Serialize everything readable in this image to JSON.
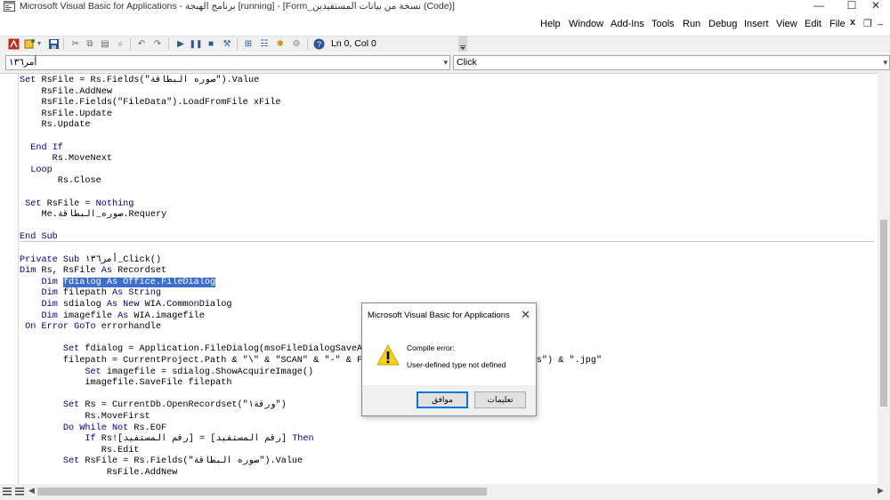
{
  "window": {
    "title": "Microsoft Visual Basic for Applications - برنامج الهبجة [running] - [Form_نسخة من  بيانات المستفيدين (Code)]",
    "minimize": "—",
    "maximize": "☐",
    "close": "✕"
  },
  "menubar": {
    "items": [
      "File",
      "Edit",
      "View",
      "Insert",
      "Debug",
      "Run",
      "Tools",
      "Add-Ins",
      "Window",
      "Help"
    ],
    "mdi_close": "x",
    "mdi_restore": "❐",
    "mdi_minimize": "_"
  },
  "toolbar": {
    "position": "Ln 0, Col 0"
  },
  "combos": {
    "object": "أمر١٣٦",
    "procedure": "Click"
  },
  "code_lines": [
    [
      {
        "t": "Set",
        "k": 1
      },
      {
        "t": " RsFile = Rs.Fields(\"صوره البطاقة\").Value"
      }
    ],
    [
      {
        "t": "    RsFile.AddNew"
      }
    ],
    [
      {
        "t": "    RsFile.Fields(\"FileData\").LoadFromFile xFile"
      }
    ],
    [
      {
        "t": "    RsFile.Update"
      }
    ],
    [
      {
        "t": "    Rs.Update"
      }
    ],
    [
      {
        "t": ""
      }
    ],
    [
      {
        "t": "  "
      },
      {
        "t": "End If",
        "k": 1
      }
    ],
    [
      {
        "t": "      Rs.MoveNext"
      }
    ],
    [
      {
        "t": "  "
      },
      {
        "t": "Loop",
        "k": 1
      }
    ],
    [
      {
        "t": "       Rs.Close"
      }
    ],
    [
      {
        "t": ""
      }
    ],
    [
      {
        "t": " "
      },
      {
        "t": "Set",
        "k": 1
      },
      {
        "t": " RsFile = "
      },
      {
        "t": "Nothing",
        "k": 1
      }
    ],
    [
      {
        "t": "    Me.صوره_البطاقة.Requery"
      }
    ],
    [
      {
        "t": ""
      }
    ],
    [
      {
        "t": "End Sub",
        "k": 1
      }
    ],
    [
      {
        "t": ""
      }
    ],
    [
      {
        "t": "Private Sub",
        "k": 1
      },
      {
        "t": " أمر١٣٦_Click()"
      }
    ],
    [
      {
        "t": "Dim",
        "k": 1
      },
      {
        "t": " Rs, RsFile "
      },
      {
        "t": "As",
        "k": 1
      },
      {
        "t": " Recordset"
      }
    ],
    [
      {
        "t": "    "
      },
      {
        "t": "Dim",
        "k": 1
      },
      {
        "t": " "
      },
      {
        "t": "fdialog As Office.FileDialog",
        "s": 1
      }
    ],
    [
      {
        "t": "    "
      },
      {
        "t": "Dim",
        "k": 1
      },
      {
        "t": " filepath "
      },
      {
        "t": "As String",
        "k": 1
      }
    ],
    [
      {
        "t": "    "
      },
      {
        "t": "Dim",
        "k": 1
      },
      {
        "t": " sdialog "
      },
      {
        "t": "As New",
        "k": 1
      },
      {
        "t": " WIA.CommonDialog"
      }
    ],
    [
      {
        "t": "    "
      },
      {
        "t": "Dim",
        "k": 1
      },
      {
        "t": " imagefile "
      },
      {
        "t": "As",
        "k": 1
      },
      {
        "t": " WIA.imagefile"
      }
    ],
    [
      {
        "t": " "
      },
      {
        "t": "On Error GoTo",
        "k": 1
      },
      {
        "t": " errorhandle"
      }
    ],
    [
      {
        "t": ""
      }
    ],
    [
      {
        "t": "        "
      },
      {
        "t": "Set",
        "k": 1
      },
      {
        "t": " fdialog = Application.FileDialog(msoFileDialogSaveAs)"
      }
    ],
    [
      {
        "t": "        filepath = CurrentProject.Path & \"\\\" & \"SCAN\" & \"-\" & Format(Now(), \"yyyymmdd\" & \"hhmmss\") & \".jpg\""
      }
    ],
    [
      {
        "t": "            "
      },
      {
        "t": "Set",
        "k": 1
      },
      {
        "t": " imagefile = sdialog.ShowAcquireImage()"
      }
    ],
    [
      {
        "t": "            imagefile.SaveFile filepath"
      }
    ],
    [
      {
        "t": ""
      }
    ],
    [
      {
        "t": "        "
      },
      {
        "t": "Set",
        "k": 1
      },
      {
        "t": " Rs = CurrentDb.OpenRecordset(\"ورقة١\")"
      }
    ],
    [
      {
        "t": "            Rs.MoveFirst"
      }
    ],
    [
      {
        "t": "        "
      },
      {
        "t": "Do While Not",
        "k": 1
      },
      {
        "t": " Rs.EOF"
      }
    ],
    [
      {
        "t": "            "
      },
      {
        "t": "If",
        "k": 1
      },
      {
        "t": " Rs![رقم المستفيد] = [رقم المستفيد] "
      },
      {
        "t": "Then",
        "k": 1
      }
    ],
    [
      {
        "t": "               Rs.Edit"
      }
    ],
    [
      {
        "t": "        "
      },
      {
        "t": "Set",
        "k": 1
      },
      {
        "t": " RsFile = Rs.Fields(\"صوره البطاقة\").Value"
      }
    ],
    [
      {
        "t": "                RsFile.AddNew"
      }
    ]
  ],
  "dialog": {
    "title": "Microsoft Visual Basic for Applications",
    "close": "✕",
    "message1": "Compile error:",
    "message2": "User-defined type not defined",
    "ok_label": "موافق",
    "help_label": "تعليمات"
  },
  "colors": {
    "keyword": "#00008b",
    "selection": "#3c6ed2"
  }
}
